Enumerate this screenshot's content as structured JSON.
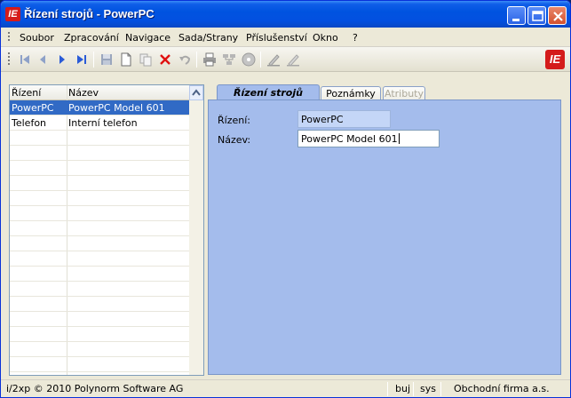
{
  "window": {
    "title": "Řízení strojů - PowerPC",
    "app_icon_text": "IE"
  },
  "menu": {
    "items": [
      {
        "label": "Soubor"
      },
      {
        "label": "Zpracování"
      },
      {
        "label": "Navigace"
      },
      {
        "label": "Sada/Strany"
      },
      {
        "label": "Příslušenství"
      },
      {
        "label": "Okno"
      },
      {
        "label": "?"
      }
    ]
  },
  "toolbar": {
    "icons": [
      "first-record-icon",
      "previous-record-icon",
      "next-record-icon",
      "last-record-icon",
      "save-icon",
      "new-icon",
      "copy-icon",
      "delete-icon",
      "undo-icon",
      "print-icon",
      "network-icon",
      "cd-icon",
      "edit-pen-icon",
      "edit-pen-alt-icon"
    ],
    "brand_text": "IE",
    "colors": {
      "delete": "#e01010",
      "nav": "#2a5bd7"
    }
  },
  "list": {
    "columns": [
      "Řízení",
      "Název"
    ],
    "rows": [
      {
        "code": "PowerPC",
        "name": "PowerPC Model 601",
        "selected": true
      },
      {
        "code": "Telefon",
        "name": "Interní telefon",
        "selected": false
      }
    ]
  },
  "detail": {
    "tabs": [
      {
        "label": "Řízení strojů",
        "state": "active"
      },
      {
        "label": "Poznámky",
        "state": "normal"
      },
      {
        "label": "Atributy",
        "state": "disabled"
      }
    ],
    "fields": {
      "control_label": "Řízení:",
      "control_value": "PowerPC",
      "name_label": "Název:",
      "name_value": "PowerPC Model 601"
    }
  },
  "status": {
    "copyright": "i/2xp © 2010 Polynorm Software AG",
    "user": "buj",
    "system": "sys",
    "company": "Obchodní firma a.s."
  },
  "colors": {
    "titlebar": "#0053e0",
    "selection": "#316ac5",
    "panel": "#a4bcec"
  }
}
